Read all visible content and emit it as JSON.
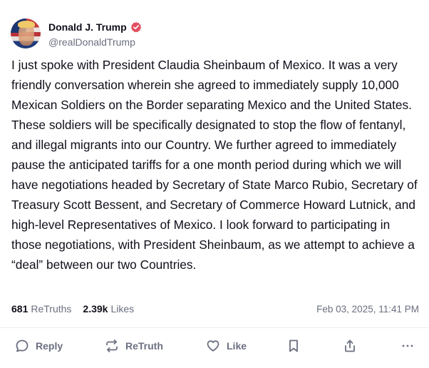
{
  "author": {
    "display_name": "Donald J. Trump",
    "handle": "@realDonaldTrump",
    "avatar_icon": "profile-photo-flag",
    "verified_icon": "verified-badge-icon",
    "verified_color": "#e04e5f"
  },
  "post": {
    "text": "I just spoke with President Claudia Sheinbaum of Mexico. It was a very friendly conversation wherein she agreed to immediately supply 10,000 Mexican Soldiers on the Border separating Mexico and the United States. These soldiers will be specifically designated to stop the flow of fentanyl, and illegal migrants into our Country. We further agreed to immediately pause the anticipated tariffs for a one month period during which we will have negotiations headed by Secretary of State Marco Rubio, Secretary of Treasury Scott Bessent, and Secretary of Commerce Howard Lutnick, and high-level Representatives of Mexico. I look forward to participating in those negotiations, with President Sheinbaum, as we attempt to achieve a “deal” between our two Countries."
  },
  "stats": {
    "retruths_count": "681",
    "retruths_label": "ReTruths",
    "likes_count": "2.39k",
    "likes_label": "Likes",
    "timestamp": "Feb 03, 2025, 11:41 PM"
  },
  "actions": {
    "reply_label": "Reply",
    "retruth_label": "ReTruth",
    "like_label": "Like",
    "reply_icon": "chat-bubble-icon",
    "retruth_icon": "repost-arrows-icon",
    "like_icon": "heart-icon",
    "bookmark_icon": "bookmark-icon",
    "share_icon": "share-icon",
    "more_icon": "more-dots-icon"
  }
}
